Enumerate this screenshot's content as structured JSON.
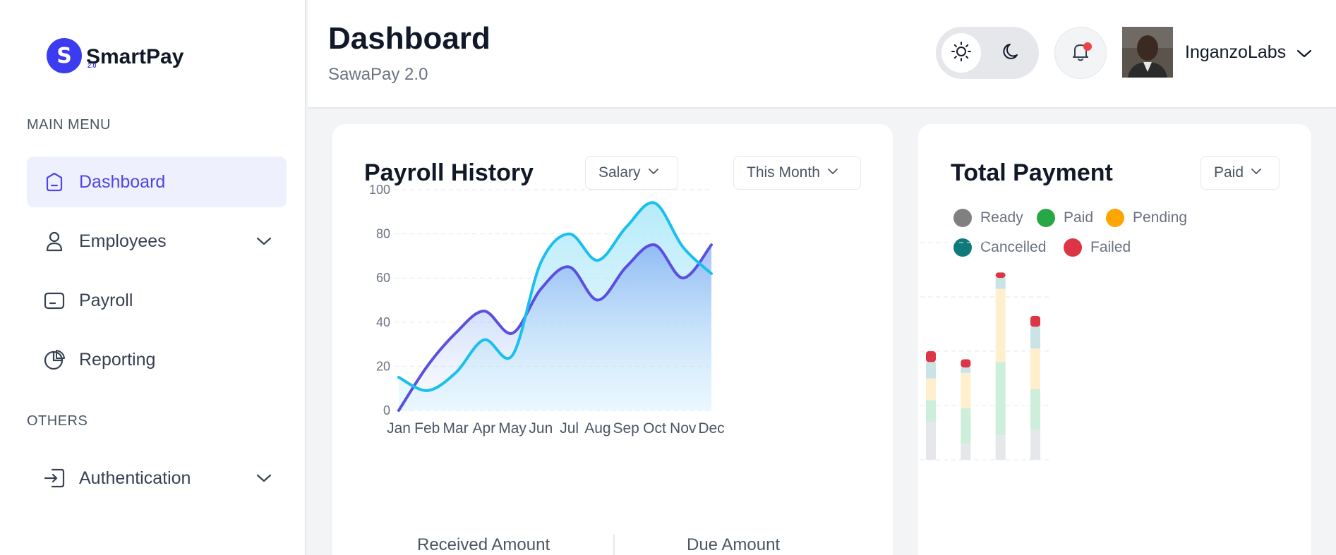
{
  "brand": {
    "name": "SmartPay",
    "version": "2.0",
    "logo_letter": "S"
  },
  "sidebar": {
    "main_menu_label": "MAIN MENU",
    "others_label": "OTHERS",
    "items": [
      {
        "label": "Dashboard",
        "icon": "home-icon",
        "active": true
      },
      {
        "label": "Employees",
        "icon": "user-icon",
        "has_submenu": true
      },
      {
        "label": "Payroll",
        "icon": "wallet-icon"
      },
      {
        "label": "Reporting",
        "icon": "pie-chart-icon"
      }
    ],
    "others": [
      {
        "label": "Authentication",
        "icon": "login-icon",
        "has_submenu": true
      }
    ]
  },
  "header": {
    "title": "Dashboard",
    "subtitle": "SawaPay 2.0",
    "user_name": "InganzoLabs"
  },
  "payroll_card": {
    "title": "Payroll History",
    "filter_type": "Salary",
    "filter_period": "This Month",
    "footer_labels": [
      "Received Amount",
      "Due Amount"
    ]
  },
  "total_card": {
    "title": "Total Payment",
    "filter_status": "Paid"
  },
  "colors": {
    "accent": "#4f46e5",
    "received_line": "#5b4fe0",
    "due_line": "#19c0ee",
    "ready": "#808080",
    "paid": "#28a745",
    "pending": "#ffa500",
    "cancelled": "#0e7a7a",
    "failed": "#dc3545"
  },
  "chart_data": [
    {
      "type": "area",
      "x": [
        "Jan",
        "Feb",
        "Mar",
        "Apr",
        "May",
        "Jun",
        "Jul",
        "Aug",
        "Sep",
        "Oct",
        "Nov",
        "Dec"
      ],
      "ylim": [
        0,
        100
      ],
      "yticks": [
        0,
        20,
        40,
        60,
        80,
        100
      ],
      "grid": true,
      "series": [
        {
          "name": "Received Amount",
          "values": [
            0,
            20,
            35,
            45,
            35,
            55,
            65,
            50,
            65,
            75,
            60,
            75
          ]
        },
        {
          "name": "Due Amount",
          "values": [
            15,
            9,
            17,
            32,
            25,
            67,
            80,
            68,
            83,
            94,
            74,
            62
          ]
        }
      ]
    },
    {
      "type": "bar",
      "stacked": true,
      "ylim": [
        0,
        80
      ],
      "yticks": [
        0,
        20,
        40,
        60,
        80
      ],
      "grid": true,
      "legend_position": "top-left",
      "series": [
        {
          "name": "Ready",
          "values": [
            10,
            12,
            8,
            14,
            6,
            9,
            11
          ]
        },
        {
          "name": "Paid",
          "values": [
            13,
            23,
            20,
            8,
            13,
            27,
            15
          ]
        },
        {
          "name": "Pending",
          "values": [
            13,
            23,
            20,
            8,
            13,
            27,
            15
          ]
        },
        {
          "name": "Cancelled",
          "values": [
            5,
            7,
            3,
            6,
            2,
            4,
            8
          ]
        },
        {
          "name": "Failed",
          "values": [
            3,
            2,
            5,
            4,
            3,
            2,
            4
          ]
        }
      ]
    }
  ]
}
